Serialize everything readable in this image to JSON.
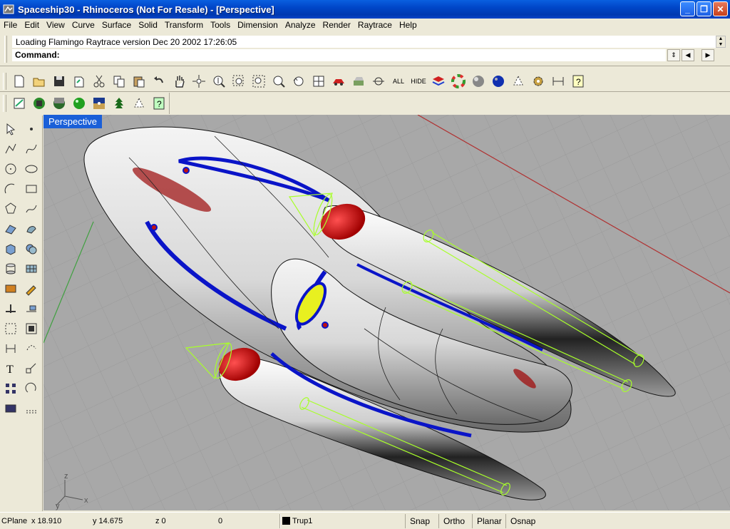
{
  "window": {
    "title": "Spaceship30 - Rhinoceros (Not For Resale) - [Perspective]",
    "buttons": [
      "minimize",
      "restore",
      "close"
    ]
  },
  "menu": [
    "File",
    "Edit",
    "View",
    "Curve",
    "Surface",
    "Solid",
    "Transform",
    "Tools",
    "Dimension",
    "Analyze",
    "Render",
    "Raytrace",
    "Help"
  ],
  "command": {
    "history": "Loading Flamingo Raytrace version Dec 20 2002 17:26:05",
    "prompt": "Command:"
  },
  "toolbar_main": [
    "new-icon",
    "open-icon",
    "save-icon",
    "print-setup-icon",
    "cut-icon",
    "copy-icon",
    "paste-icon",
    "undo-icon",
    "pan-hand-icon",
    "rotate-view-icon",
    "zoom-dynamic-icon",
    "zoom-window-icon",
    "zoom-extents-icon",
    "zoom-selected-icon",
    "undo-view-icon",
    "four-viewports-icon",
    "shade-icon",
    "render-preview-icon",
    "grid-snap-icon",
    "show-all-icon",
    "hide-icon",
    "layers-icon",
    "color-wheel-icon",
    "render-sphere-icon",
    "blue-sphere-icon",
    "light-icon",
    "options-gear-icon",
    "dimension-icon",
    "help-icon"
  ],
  "toolbar_main_text": {
    "all": "ALL",
    "hide": "HIDE"
  },
  "toolbar_render": [
    "raytrace-render-icon",
    "save-render-icon",
    "environment-icon",
    "material-sphere-icon",
    "landscape-icon",
    "plant-icon",
    "light-cone-icon",
    "render-help-icon"
  ],
  "left_toolbar": [
    "select-arrow-icon",
    "point-icon",
    "polyline-icon",
    "curve-icon",
    "circle-icon",
    "ellipse-icon",
    "arc-icon",
    "rectangle-icon",
    "polygon-icon",
    "freeform-icon",
    "surface-icon",
    "surface-edit-icon",
    "box-icon",
    "boolean-icon",
    "cylinder-icon",
    "mesh-icon",
    "fillet-icon",
    "extend-icon",
    "split-icon",
    "trim-icon",
    "group-icon",
    "block-icon",
    "dimension-icon",
    "transform-icon",
    "text-icon",
    "scale-icon",
    "array-icon",
    "rotate-icon",
    "layer-icon",
    "grid-icon"
  ],
  "viewport": {
    "label": "Perspective",
    "axis_labels": {
      "x": "x",
      "y": "y",
      "z": "z"
    }
  },
  "status": {
    "cplane": "CPlane",
    "x": "x 18.910",
    "y": "y 14.675",
    "z": "z 0",
    "extra": "0",
    "layer": "Trup1",
    "snap": "Snap",
    "ortho": "Ortho",
    "planar": "Planar",
    "osnap": "Osnap"
  },
  "colors": {
    "titlebar": "#0046c8",
    "viewport_bg": "#a8a8a8",
    "viewport_label_bg": "#1a5fd8",
    "accent_blue": "#0a14c8",
    "accent_red": "#d01010",
    "light_green": "#a8ff2a"
  }
}
